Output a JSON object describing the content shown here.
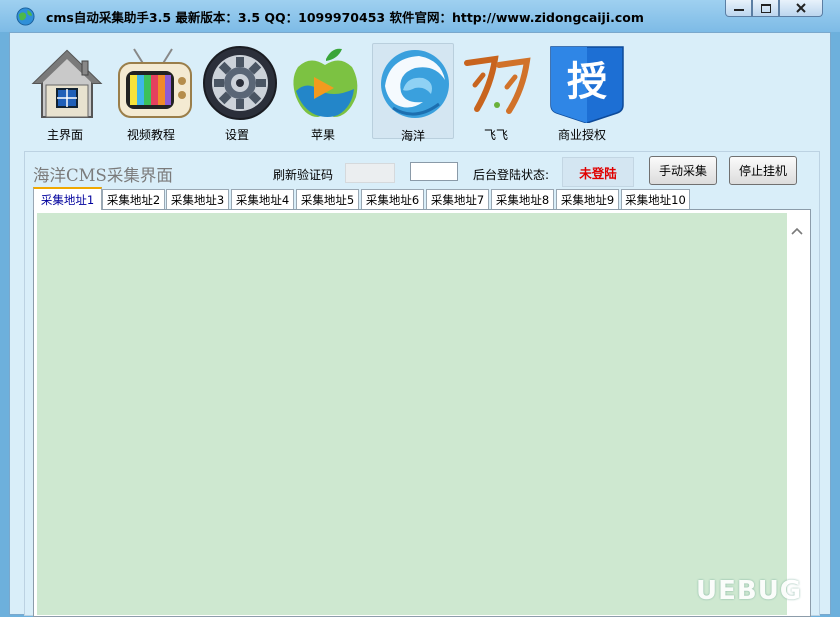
{
  "window": {
    "title": "cms自动采集助手3.5   最新版本：3.5   QQ：1099970453   软件官网：http://www.zidongcaiji.com"
  },
  "toolbar": {
    "items": [
      {
        "label": "主界面",
        "icon": "home-icon"
      },
      {
        "label": "视频教程",
        "icon": "tv-icon"
      },
      {
        "label": "设置",
        "icon": "gear-icon"
      },
      {
        "label": "苹果",
        "icon": "apple-icon"
      },
      {
        "label": "海洋",
        "icon": "ocean-icon",
        "active": true
      },
      {
        "label": "飞飞",
        "icon": "feifei-icon"
      },
      {
        "label": "商业授权",
        "icon": "license-icon",
        "glyph": "授"
      }
    ]
  },
  "panel": {
    "title": "海洋CMS采集界面",
    "refresh_captcha_label": "刷新验证码",
    "captcha_input_value": "",
    "login_status_label": "后台登陆状态:",
    "login_status_value": "未登陆",
    "manual_collect_button": "手动采集",
    "stop_hang_button": "停止挂机"
  },
  "tabs": [
    {
      "label": "采集地址1",
      "active": true
    },
    {
      "label": "采集地址2"
    },
    {
      "label": "采集地址3"
    },
    {
      "label": "采集地址4"
    },
    {
      "label": "采集地址5"
    },
    {
      "label": "采集地址6"
    },
    {
      "label": "采集地址7"
    },
    {
      "label": "采集地址8"
    },
    {
      "label": "采集地址9"
    },
    {
      "label": "采集地址10"
    }
  ],
  "watermark": "UEBUG",
  "colors": {
    "content_bg": "#cee8d0",
    "status_text": "#e00000",
    "active_tab_text": "#00009c",
    "active_tab_accent": "#f0a800"
  }
}
